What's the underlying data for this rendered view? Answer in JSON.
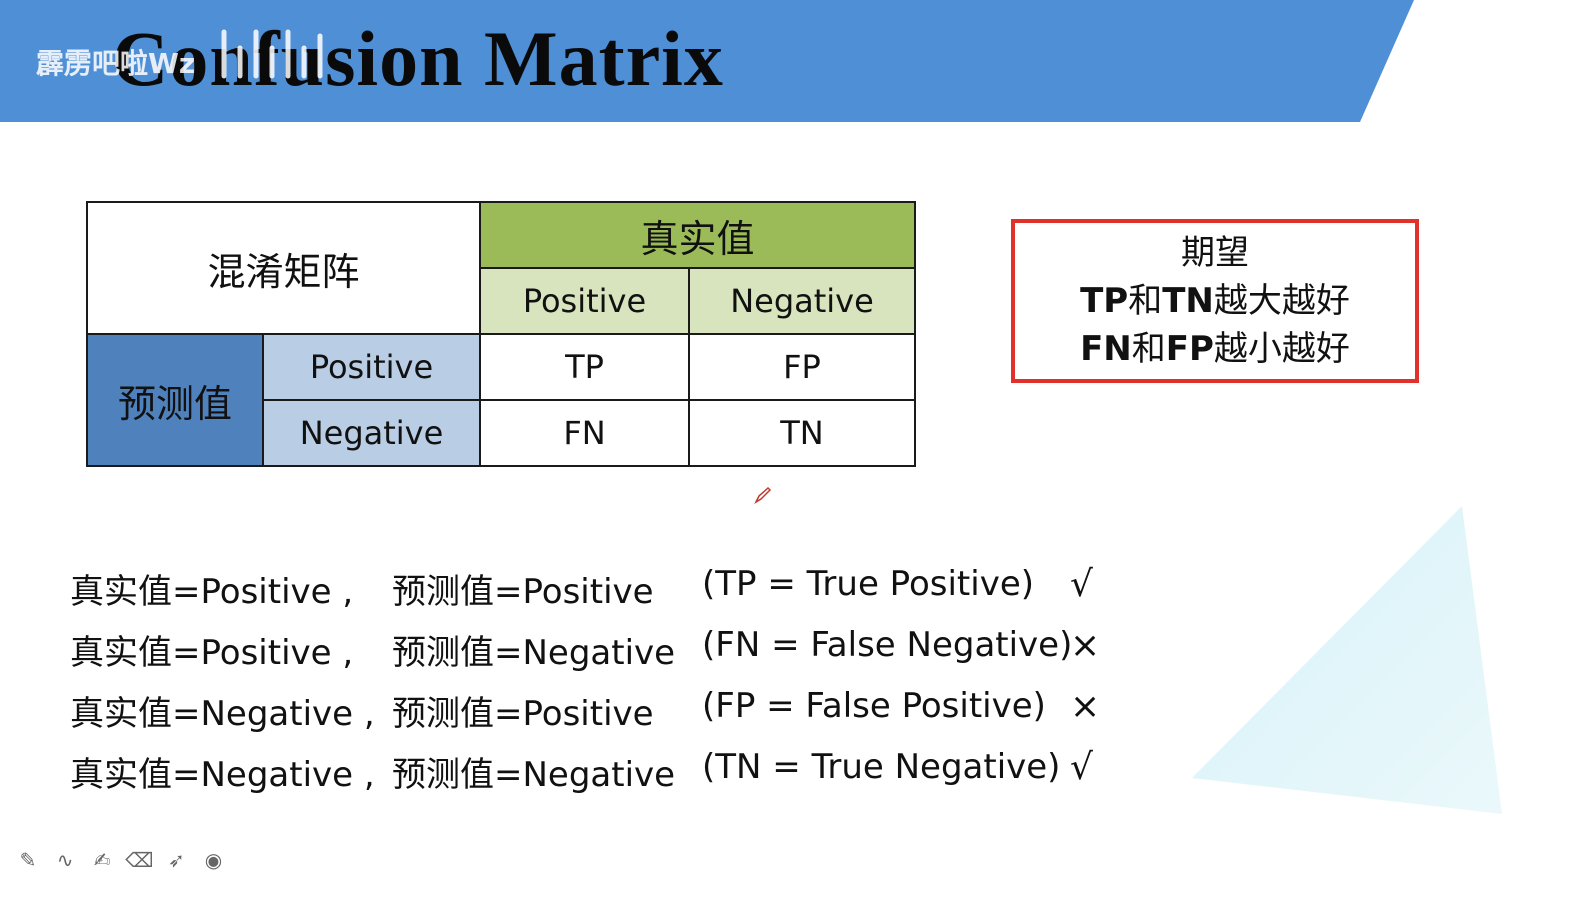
{
  "header": {
    "title": "Confusion Matrix",
    "watermark": "霹雳吧啦Wz",
    "band_color": "#4f8fd6"
  },
  "matrix": {
    "corner_label": "混淆矩阵",
    "actual_label": "真实值",
    "predicted_label": "预测值",
    "actual_positive": "Positive",
    "actual_negative": "Negative",
    "predicted_positive": "Positive",
    "predicted_negative": "Negative",
    "cells": [
      [
        "TP",
        "FP"
      ],
      [
        "FN",
        "TN"
      ]
    ],
    "colors": {
      "actual_header": "#9bbb59",
      "actual_sub": "#d7e4bd",
      "predicted_header": "#4f81bd",
      "predicted_sub": "#b9cde5"
    }
  },
  "expectation": {
    "title": "期望",
    "line1": {
      "a": "TP",
      "b": "和",
      "c": "TN",
      "d": "越大越好"
    },
    "line2": {
      "a": "FN",
      "b": "和",
      "c": "FP",
      "d": "越小越好"
    },
    "border_color": "#e0312a"
  },
  "definitions": [
    {
      "actual": "真实值=Positive ,",
      "predicted": "预测值=Positive",
      "meaning": "(TP = True   Positive)",
      "mark": "√"
    },
    {
      "actual": "真实值=Positive ,",
      "predicted": "预测值=Negative",
      "meaning": "(FN = False Negative)",
      "mark": "×"
    },
    {
      "actual": "真实值=Negative ,",
      "predicted": "预测值=Positive",
      "meaning": "(FP = False  Positive)",
      "mark": "×"
    },
    {
      "actual": "真实值=Negative ,",
      "predicted": "预测值=Negative",
      "meaning": "(TN = True  Negative)",
      "mark": "√"
    }
  ],
  "toolbar": {
    "icons": [
      "pen-icon",
      "curve-icon",
      "highlighter-icon",
      "eraser-icon",
      "pointer-icon",
      "record-icon"
    ],
    "glyphs": [
      "✎",
      "∿",
      "✍",
      "⌫",
      "➶",
      "◉"
    ]
  }
}
